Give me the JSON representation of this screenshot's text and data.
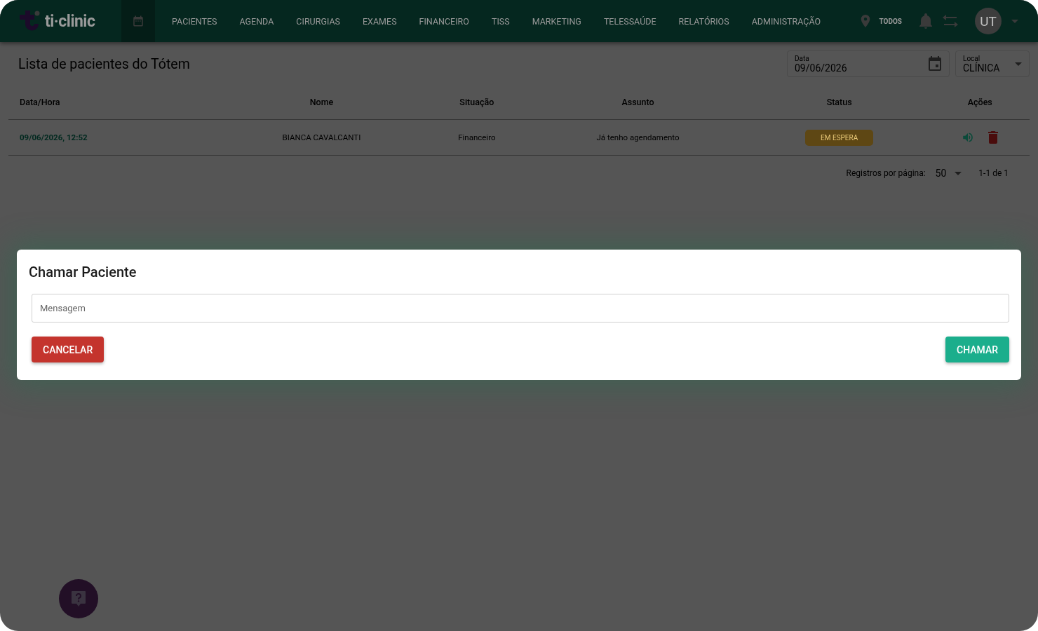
{
  "header": {
    "brand": "ti·clinic",
    "nav": [
      {
        "label": "PACIENTES"
      },
      {
        "label": "AGENDA"
      },
      {
        "label": "CIRURGIAS"
      },
      {
        "label": "EXAMES"
      },
      {
        "label": "FINANCEIRO"
      },
      {
        "label": "TISS"
      },
      {
        "label": "MARKETING"
      },
      {
        "label": "TELESSAÚDE"
      },
      {
        "label": "RELATÓRIOS"
      },
      {
        "label": "ADMINISTRAÇÃO"
      }
    ],
    "location": "TODOS",
    "avatar": "UT"
  },
  "page": {
    "title": "Lista de pacientes do Tótem",
    "date_field": {
      "label": "Data",
      "value": "09/06/2026"
    },
    "local_field": {
      "label": "Local",
      "value": "CLÍNICA"
    }
  },
  "table": {
    "columns": [
      "Data/Hora",
      "Nome",
      "Situação",
      "Assunto",
      "Status",
      "Ações"
    ],
    "rows": [
      {
        "datetime": "09/06/2026, 12:52",
        "name": "BIANCA CAVALCANTI",
        "situation": "Financeiro",
        "subject": "Já tenho agendamento",
        "status": "EM ESPERA"
      }
    ]
  },
  "pagination": {
    "label": "Registros por página:",
    "per_page": "50",
    "range": "1-1 de 1"
  },
  "dialog": {
    "title": "Chamar Paciente",
    "field": {
      "placeholder": "Mensagem"
    },
    "buttons": [
      {
        "label": "CANCELAR",
        "kind": "danger"
      },
      {
        "label": "CHAMAR",
        "kind": "primary"
      }
    ]
  }
}
